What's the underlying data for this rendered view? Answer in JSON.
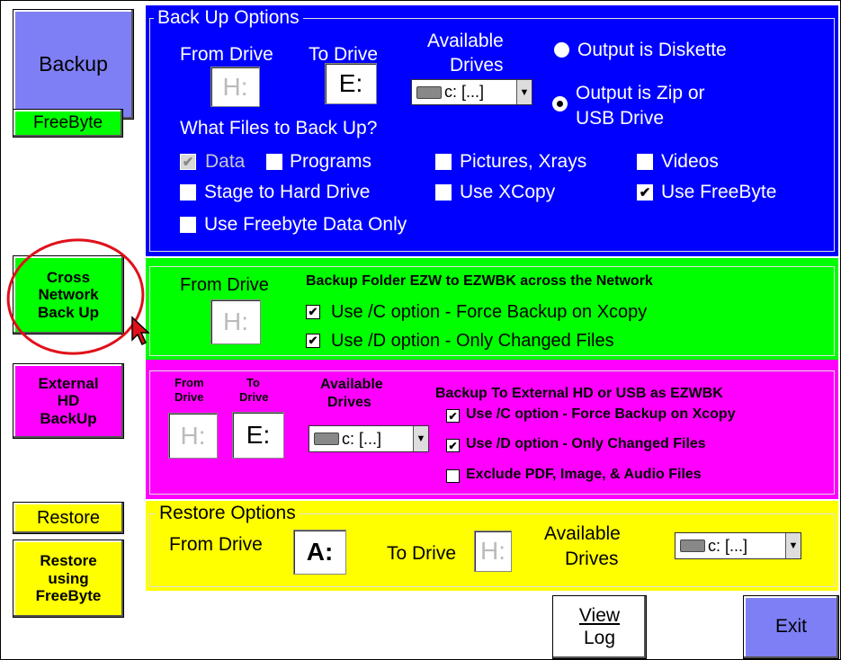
{
  "left_buttons": {
    "backup": "Backup",
    "freebyte": "FreeByte",
    "cross_network": [
      "Cross",
      "Network",
      "Back Up"
    ],
    "external_hd": [
      "External",
      "HD",
      "BackUp"
    ],
    "restore": "Restore",
    "restore_freebyte": [
      "Restore",
      "using",
      "FreeByte"
    ]
  },
  "backup_options": {
    "legend": "Back Up Options",
    "from_drive_label": "From Drive",
    "to_drive_label": "To Drive",
    "available_label": [
      "Available",
      "Drives"
    ],
    "from_drive": "H:",
    "to_drive": "E:",
    "combo_value": "c: [...]",
    "radio_diskette": "Output is Diskette",
    "radio_zip": [
      "Output is Zip or",
      "USB Drive"
    ],
    "what_files": "What Files to Back Up?",
    "checkboxes": {
      "data": {
        "label": "Data",
        "checked": true
      },
      "programs": {
        "label": "Programs",
        "checked": false
      },
      "pictures": {
        "label": "Pictures, Xrays",
        "checked": false
      },
      "videos": {
        "label": "Videos",
        "checked": false
      },
      "stage": {
        "label": "Stage to Hard Drive",
        "checked": false
      },
      "xcopy": {
        "label": "Use XCopy",
        "checked": false
      },
      "freebyte": {
        "label": "Use FreeByte",
        "checked": true
      },
      "freebyte_only": {
        "label": "Use Freebyte Data Only",
        "checked": false
      }
    }
  },
  "network": {
    "from_drive_label": "From Drive",
    "title": "Backup Folder EZW to EZWBK across the Network",
    "from_drive": "H:",
    "opt_c": "Use /C option - Force Backup on Xcopy",
    "opt_d": "Use /D option - Only Changed Files"
  },
  "external": {
    "from_label": [
      "From",
      "Drive"
    ],
    "to_label": [
      "To",
      "Drive"
    ],
    "available_label": [
      "Available",
      "Drives"
    ],
    "from_drive": "H:",
    "to_drive": "E:",
    "combo_value": "c: [...]",
    "title": "Backup To External HD or USB as EZWBK",
    "opt_c": "Use /C option - Force Backup on Xcopy",
    "opt_d": "Use /D option - Only Changed Files",
    "opt_exclude": "Exclude PDF, Image, & Audio Files"
  },
  "restore": {
    "legend": "Restore Options",
    "from_label": "From Drive",
    "from_drive": "A:",
    "to_label": "To Drive",
    "to_drive": "H:",
    "available_label": [
      "Available",
      "Drives"
    ],
    "combo_value": "c: [...]"
  },
  "bottom": {
    "view_log": [
      "View",
      "Log"
    ],
    "exit": "Exit"
  },
  "colors": {
    "backup_panel": "#0000ff",
    "network_panel": "#00ff00",
    "external_panel": "#ff00ff",
    "restore_panel": "#ffff00",
    "highlight_circle": "#e0101a"
  }
}
